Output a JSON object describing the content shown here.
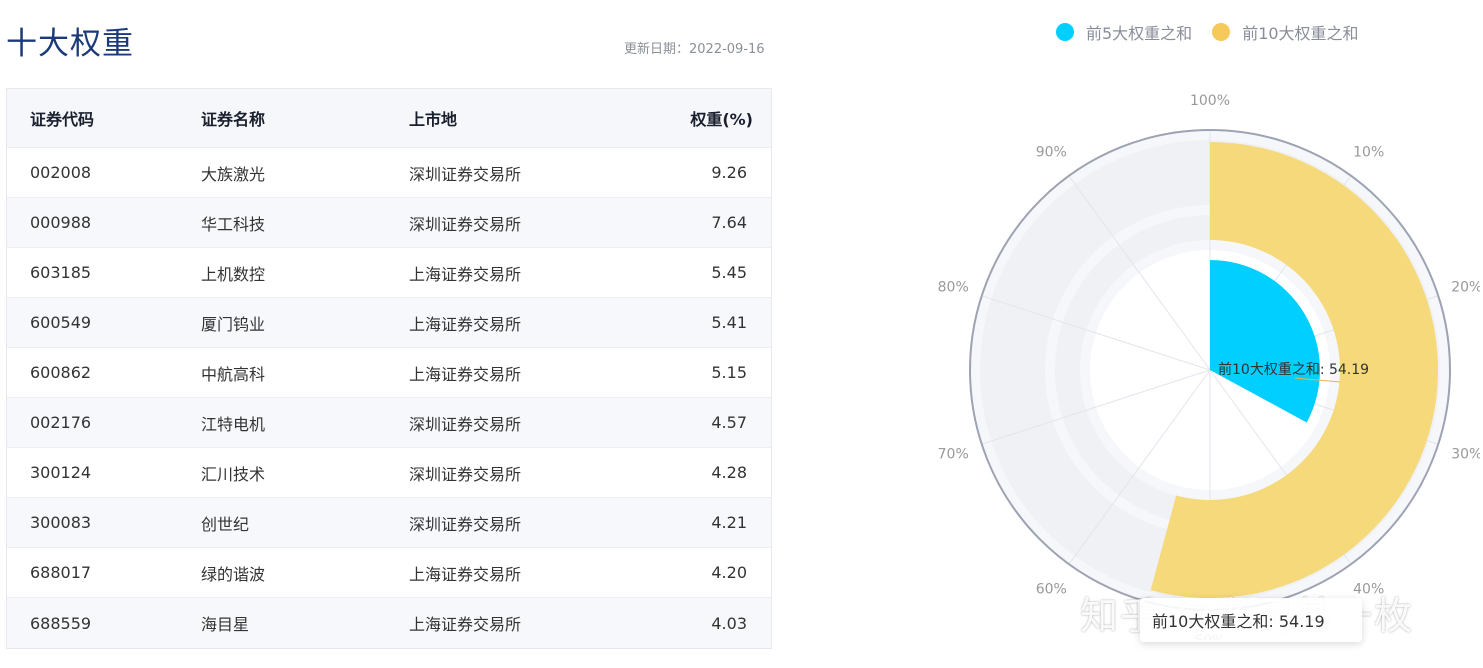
{
  "header": {
    "title": "十大权重",
    "update_date": "更新日期：2022-09-16"
  },
  "table": {
    "columns": [
      "证券代码",
      "证券名称",
      "上市地",
      "权重(%)"
    ],
    "rows": [
      [
        "002008",
        "大族激光",
        "深圳证券交易所",
        "9.26"
      ],
      [
        "000988",
        "华工科技",
        "深圳证券交易所",
        "7.64"
      ],
      [
        "603185",
        "上机数控",
        "上海证券交易所",
        "5.45"
      ],
      [
        "600549",
        "厦门钨业",
        "上海证券交易所",
        "5.41"
      ],
      [
        "600862",
        "中航高科",
        "上海证券交易所",
        "5.15"
      ],
      [
        "002176",
        "江特电机",
        "深圳证券交易所",
        "4.57"
      ],
      [
        "300124",
        "汇川技术",
        "深圳证券交易所",
        "4.28"
      ],
      [
        "300083",
        "创世纪",
        "深圳证券交易所",
        "4.21"
      ],
      [
        "688017",
        "绿的谐波",
        "上海证券交易所",
        "4.20"
      ],
      [
        "688559",
        "海目星",
        "上海证券交易所",
        "4.03"
      ]
    ]
  },
  "chart_data": {
    "type": "polar-bar",
    "axis_ticks": [
      "100%",
      "10%",
      "20%",
      "30%",
      "40%",
      "50%",
      "60%",
      "70%",
      "80%",
      "90%"
    ],
    "axis_range": [
      0,
      100
    ],
    "series": [
      {
        "name": "前5大权重之和",
        "value": 32.91,
        "color": "#00cfff"
      },
      {
        "name": "前10大权重之和",
        "value": 54.19,
        "color": "#f5d97a"
      }
    ],
    "label": "前10大权重之和: 54.19",
    "legend_position": "top"
  },
  "tooltip": {
    "text": "前10大权重之和: 54.19"
  },
  "watermark": "知乎 @老司基一枚"
}
